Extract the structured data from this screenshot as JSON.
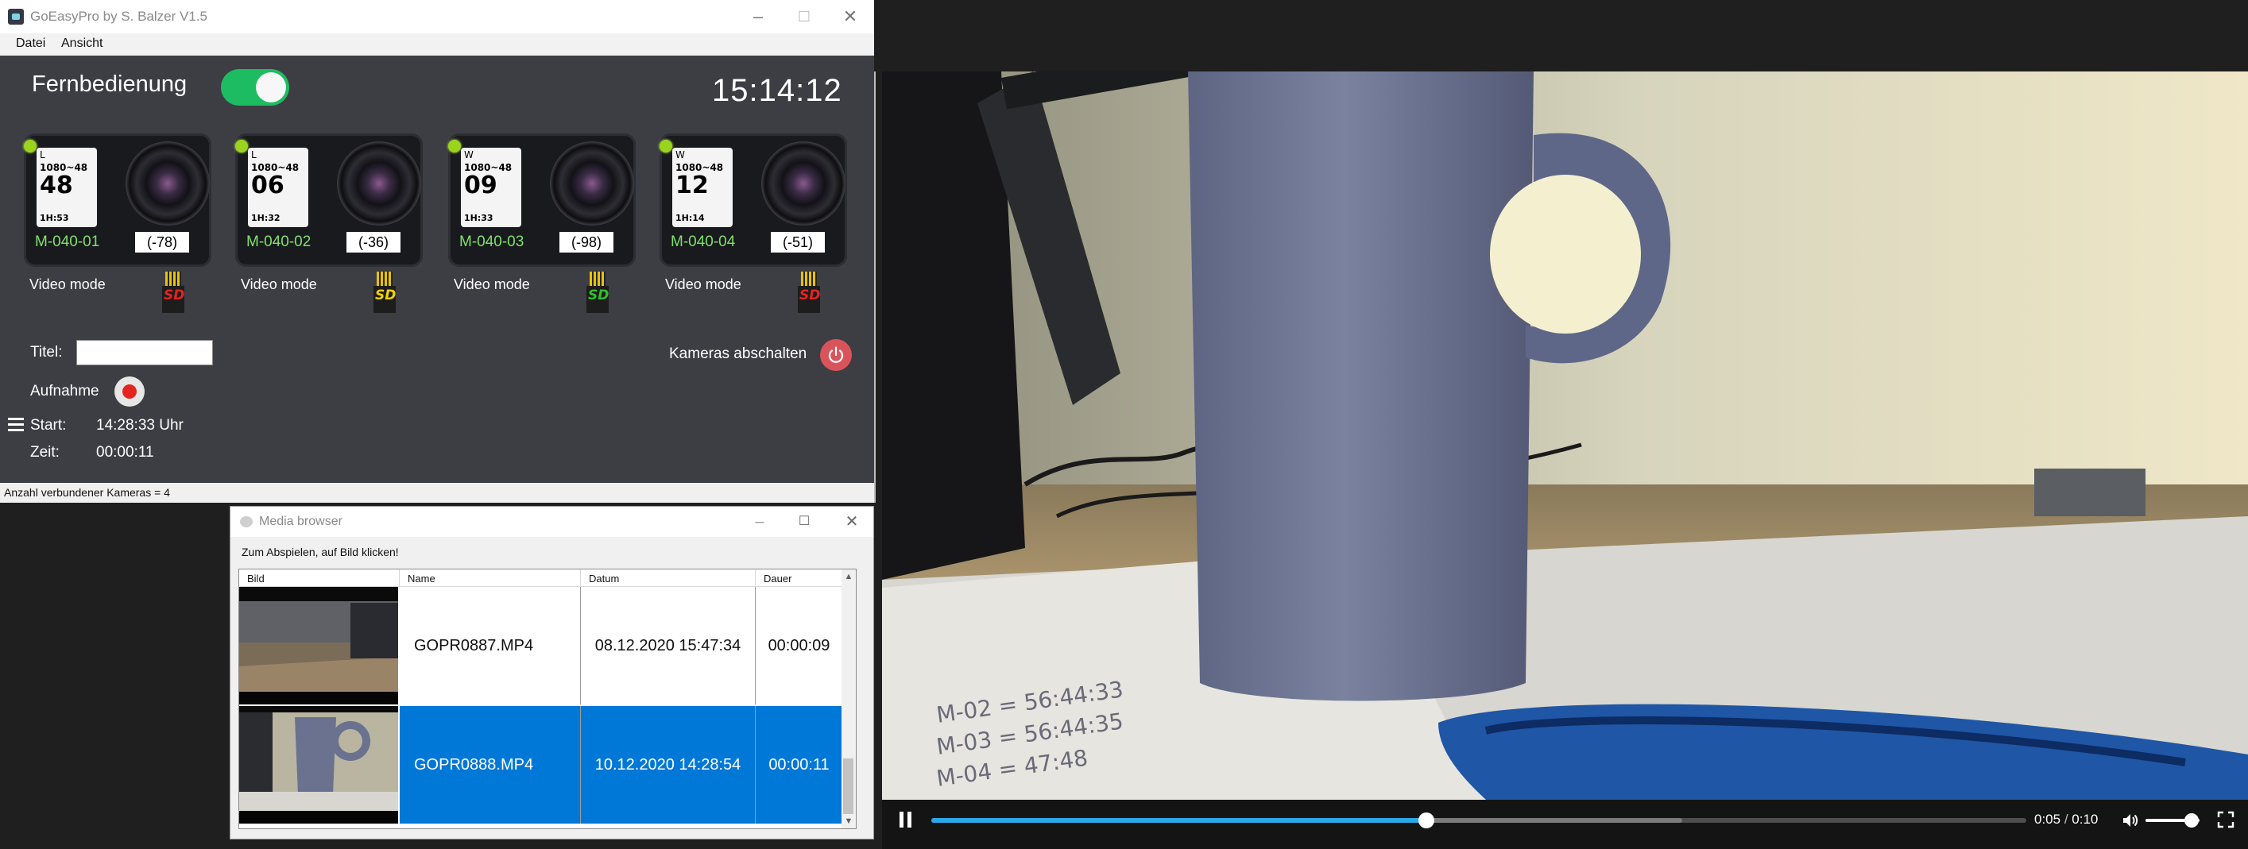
{
  "app": {
    "title": "GoEasyPro by S. Balzer V1.5",
    "menu": [
      "Datei",
      "Ansicht"
    ],
    "remote_label": "Fernbedienung",
    "remote_on": true,
    "clock": "15:14:12",
    "cameras": [
      {
        "name": "M-040-01",
        "signal": "(-78)",
        "mode": "Video mode",
        "screen_res": "1080~48",
        "screen_num": "48",
        "screen_time": "1H:53",
        "screen_mode": "L",
        "sd_color": "#e8231f"
      },
      {
        "name": "M-040-02",
        "signal": "(-36)",
        "mode": "Video mode",
        "screen_res": "1080~48",
        "screen_num": "06",
        "screen_time": "1H:32",
        "screen_mode": "L",
        "sd_color": "#f2d400"
      },
      {
        "name": "M-040-03",
        "signal": "(-98)",
        "mode": "Video mode",
        "screen_res": "1080~48",
        "screen_num": "09",
        "screen_time": "1H:33",
        "screen_mode": "W",
        "sd_color": "#2fc12b"
      },
      {
        "name": "M-040-04",
        "signal": "(-51)",
        "mode": "Video mode",
        "screen_res": "1080~48",
        "screen_num": "12",
        "screen_time": "1H:14",
        "screen_mode": "W",
        "sd_color": "#e8231f"
      }
    ],
    "title_label": "Titel:",
    "title_value": "",
    "record_label": "Aufnahme",
    "cameras_off_label": "Kameras abschalten",
    "start_label": "Start:",
    "start_value": "14:28:33 Uhr",
    "zeit_label": "Zeit:",
    "zeit_value": "00:00:11",
    "status": "Anzahl verbundener Kameras = 4"
  },
  "media_browser": {
    "title": "Media browser",
    "hint": "Zum Abspielen, auf Bild klicken!",
    "columns": [
      "Bild",
      "Name",
      "Datum",
      "Dauer"
    ],
    "rows": [
      {
        "name": "GOPR0887.MP4",
        "date": "08.12.2020 15:47:34",
        "duration": "00:00:09",
        "selected": false
      },
      {
        "name": "GOPR0888.MP4",
        "date": "10.12.2020 14:28:54",
        "duration": "00:00:11",
        "selected": true
      }
    ]
  },
  "player": {
    "current": "0:05",
    "separator": "/",
    "total": "0:10",
    "progress": 0.452,
    "buffered": 0.686,
    "volume": 0.85,
    "playing": true
  },
  "colors": {
    "accent": "#2aa9e8",
    "selection": "#0078d7",
    "toggle_on": "#1ebc62",
    "camera_name": "#7ee26b"
  }
}
